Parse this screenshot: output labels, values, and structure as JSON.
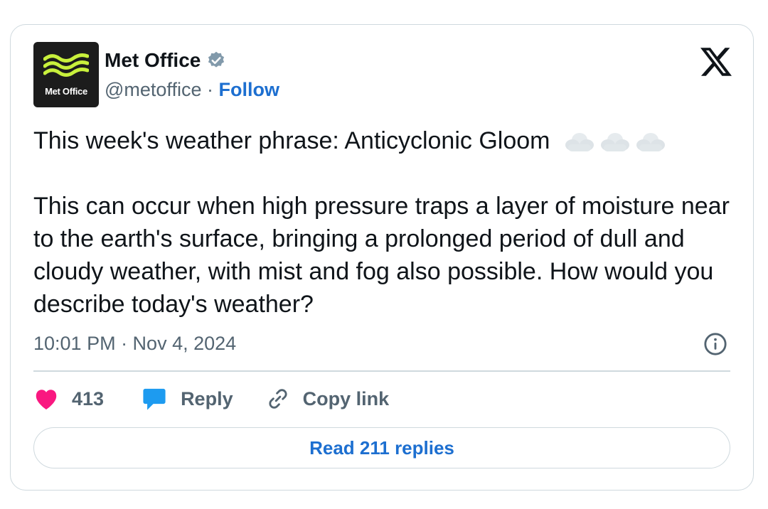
{
  "account": {
    "name": "Met Office",
    "handle": "@metoffice",
    "separator": "·",
    "follow_label": "Follow",
    "avatar_text": "Met Office",
    "verified_icon": "verified-badge-icon",
    "avatar_wave_color": "#c8f03c"
  },
  "tweet": {
    "line1": "This week's weather phrase: Anticyclonic Gloom",
    "emoji": [
      "cloud-icon",
      "cloud-icon",
      "cloud-icon"
    ],
    "body": "This can occur when high pressure traps a layer of moisture near to the earth's surface, bringing a prolonged period of dull and cloudy weather, with mist and fog also possible. How would you describe today's weather?",
    "timestamp": "10:01 PM · Nov 4, 2024"
  },
  "actions": {
    "likes_count": "413",
    "reply_label": "Reply",
    "copy_link_label": "Copy link",
    "read_replies_label": "Read 211 replies"
  },
  "colors": {
    "link": "#1d6fd0",
    "heart": "#f91880",
    "reply_icon": "#1d9bf0",
    "secondary_text": "#536471",
    "border": "#cfd9de"
  }
}
